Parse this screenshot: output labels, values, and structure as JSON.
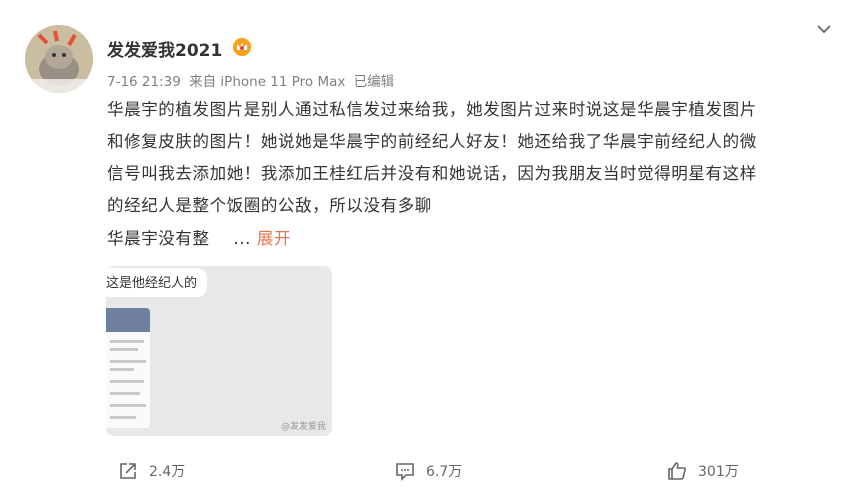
{
  "post": {
    "username": "发发爱我2021",
    "meta": {
      "time": "7-16 21:39",
      "source": "来自 iPhone 11 Pro Max",
      "edited": "已编辑"
    },
    "lines": [
      "华晨宇的植发图片是别人通过私信发过来给我，她发图片过来时说这是华晨宇植发图片",
      "和修复皮肤的图片！她说她是华晨宇的前经纪人好友！她还给我了华晨宇前经纪人的微",
      "信号叫我去添加她！我添加王桂红后并没有和她说话，因为我朋友当时觉得明星有这样",
      "的经纪人是整个饭圈的公敌，所以没有多聊"
    ],
    "truncated_text": "华晨宇没有整",
    "ellipsis": "...",
    "expand_label": "展开",
    "image": {
      "bubble_text": "这是他经纪人的",
      "watermark": "@发发爱我"
    },
    "actions": {
      "share_count": "2.4万",
      "comment_count": "6.7万",
      "like_count": "301万"
    }
  },
  "colors": {
    "accent": "#eb7350",
    "meta": "#808080"
  },
  "icons": {
    "crown": "crown-icon",
    "more": "chevron-down-icon",
    "share": "share-icon",
    "comment": "comment-icon",
    "like": "like-icon"
  }
}
